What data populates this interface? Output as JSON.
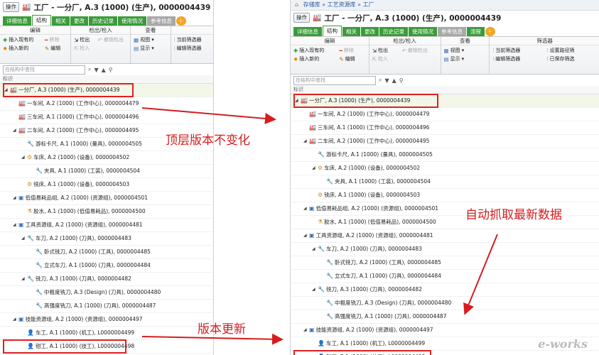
{
  "left": {
    "op_label": "操作",
    "title": "工厂 - 一分厂, A.3 (1000) (生产), 0000004439",
    "tabs": [
      "详细信息",
      "结构",
      "相关",
      "更改",
      "历史记录",
      "使用情况",
      "参考信息"
    ],
    "ribbon": {
      "edit": {
        "title": "编辑",
        "insert_existing": "插入现有的",
        "remove": "移除",
        "insert_new": "插入新的",
        "edit": "编辑"
      },
      "checkout": {
        "title": "检出/检入",
        "checkout": "检出",
        "undo_checkout": "撤销检出",
        "checkin": "检入"
      },
      "view": {
        "title": "查看",
        "view": "视图",
        "display": "显示"
      },
      "filter": {
        "current_filter": "当前筛选器",
        "edit_filter": "编辑筛选器"
      }
    },
    "search_placeholder": "在结构中查找",
    "tree_header": "标识",
    "rows": [
      "一分厂, A.3 (1000) (生产), 0000004439",
      "一车间, A.2 (1000) (工作中心), 0000004479",
      "三车间, A.1 (1000) (工作中心), 0000004496",
      "二车间, A.2 (1000) (工作中心), 0000004495",
      "游标卡尺, A.1 (1000) (量具), 0000004505",
      "车床, A.2 (1000) (设备), 0000004502",
      "夹具, A.1 (1000) (工装), 0000004504",
      "铣床, A.1 (1000) (设备), 0000004503",
      "低值易耗品组, A.2 (1000) (资源组), 0000004501",
      "胶水, A.1 (1000) (低值易耗品), 0000004500",
      "工具资源组, A.2 (1000) (资源组), 0000004481",
      "车刀, A.2 (1000) (刀具), 0000004483",
      "卧式铣刀, A.2 (1000) (工具), 0000004485",
      "立式车刀, A.1 (1000) (刀具), 0000004484",
      "铣刀, A.3 (1000) (刀具), 0000004482",
      "中粗度铣刀, A.3 (Design) (刀具), 0000004480",
      "高强度铣刀, A.1 (1000) (刀具), 0000004487",
      "技能资源组, A.2 (1000) (资源组), 0000004497",
      "车工, A.1 (1000) (机工), L0000004499",
      "钳工, A.1 (1000) (技工), L0000004498"
    ]
  },
  "right": {
    "breadcrumb": [
      "存储库",
      "工艺资源库",
      "工厂"
    ],
    "op_label": "操作",
    "title": "工厂 - 一分厂, A.3 (1000) (生产), 0000004439",
    "tabs": [
      "详细信息",
      "结构",
      "相关",
      "更改",
      "历史记录",
      "使用情况",
      "参考信息",
      "流程"
    ],
    "ribbon": {
      "edit": {
        "title": "编辑",
        "insert_existing": "插入现有的",
        "remove": "移除",
        "insert_new": "插入新的",
        "edit": "编辑"
      },
      "checkout": {
        "title": "检出/检入",
        "checkout": "检出",
        "undo_checkout": "撤销检出",
        "checkin": "检入"
      },
      "view": {
        "title": "查看",
        "view": "视图",
        "display": "显示"
      },
      "filter": {
        "title": "筛选器",
        "current_filter": "当前筛选器",
        "set_path": "设置路径筛",
        "edit_filter": "编辑筛选器",
        "saved_filter": "已保存筛选"
      }
    },
    "search_placeholder": "在结构中查找",
    "tree_header": "标识",
    "rows": [
      "一分厂, A.3 (1000) (生产), 0000004439",
      "一车间, A.2 (1000) (工作中心), 0000004479",
      "三车间, A.1 (1000) (工作中心), 0000004496",
      "二车间, A.2 (1000) (工作中心), 0000004495",
      "游标卡尺, A.1 (1000) (量具), 0000004505",
      "车床, A.2 (1000) (设备), 0000004502",
      "夹具, A.1 (1000) (工装), 0000004504",
      "铣床, A.1 (1000) (设备), 0000004503",
      "低值易耗品组, A.2 (1000) (资源组), 0000004501",
      "胶水, A.1 (1000) (低值易耗品), 0000004500",
      "工具资源组, A.2 (1000) (资源组), 0000004481",
      "车刀, A.2 (1000) (刀具), 0000004483",
      "卧式铣刀, A.2 (1000) (工具), 0000004485",
      "立式车刀, A.1 (1000) (刀具), 0000004484",
      "铣刀, A.3 (1000) (刀具), 0000004482",
      "中粗度铣刀, A.3 (Design) (刀具), 0000004480",
      "高强度铣刀, A.1 (1000) (刀具), 0000004487",
      "技能资源组, A.2 (1000) (资源组), 0000004497",
      "车工, A.1 (1000) (机工), L0000004499",
      "钳工, B.1 (1000) (技工), L0000004498"
    ]
  },
  "annotations": {
    "top_unchanged": "顶层版本不变化",
    "auto_latest": "自动抓取最新数据",
    "version_update": "版本更新"
  },
  "watermark": "e-works",
  "colors": {
    "tab_green": "#3b9b3b",
    "highlight_red": "#e02020",
    "annotation_red": "#d51d1d"
  }
}
